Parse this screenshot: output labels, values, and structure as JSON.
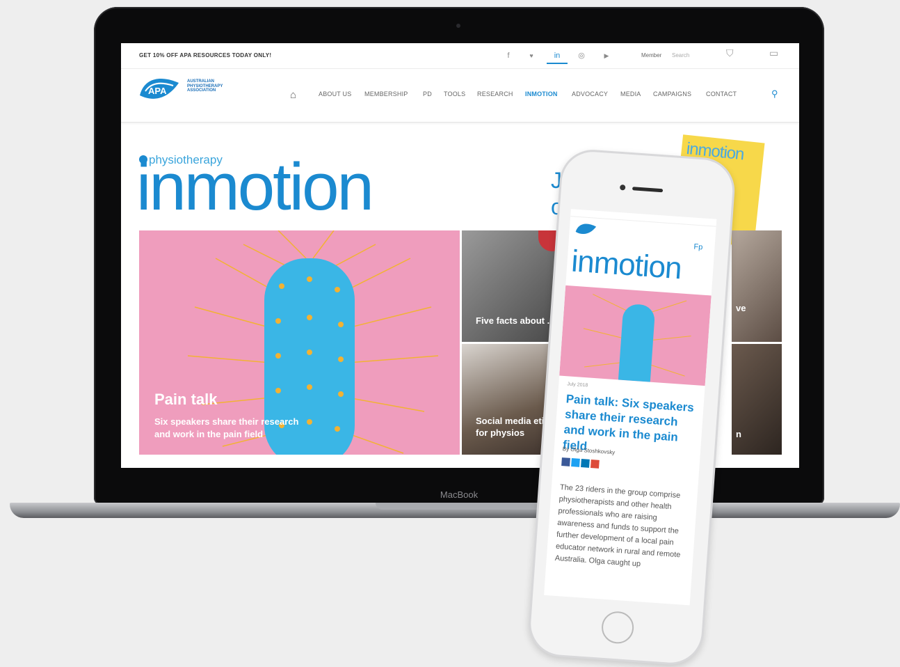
{
  "site": {
    "promo": "GET 10% OFF APA RESOURCES TODAY ONLY!",
    "social": [
      "f",
      "♥",
      "in",
      "◎",
      "▶"
    ],
    "member_label": "Member",
    "member_link": "Search",
    "logo_text": [
      "AUSTRALIAN",
      "PHYSIOTHERAPY",
      "ASSOCIATION"
    ],
    "logo_mark": "APA",
    "nav": [
      "ABOUT US",
      "MEMBERSHIP",
      "PD",
      "TOOLS",
      "RESEARCH",
      "INMOTION",
      "ADVOCACY",
      "MEDIA",
      "CAMPAIGNS",
      "CONTACT"
    ],
    "active_nav": "INMOTION",
    "kicker": "physiotherapy",
    "masthead": "inmotion",
    "side_text_1": "J",
    "side_text_2": "o",
    "magazine_title": "inmotion",
    "hero": {
      "title": "Pain talk",
      "subtitle_1": "Six speakers share their research",
      "subtitle_2": "and work in the pain field"
    },
    "tiles": [
      {
        "label_1": "Five facts about .",
        "label_2": ""
      },
      {
        "label_1": "Social media etiq",
        "label_2": "for physios"
      },
      {
        "label_1": "ve",
        "label_2": ""
      },
      {
        "label_1": "n",
        "label_2": ""
      }
    ]
  },
  "laptop": {
    "brand": "MacBook"
  },
  "phone": {
    "masthead": "inmotion",
    "nav_short": "Fp",
    "date": "July 2018",
    "title": "Pain talk: Six speakers share their research and work in the pain field",
    "byline": "By Olga Stoshkovsky",
    "body": "The 23 riders in the group comprise physiotherapists and other health professionals who are raising awareness and funds to support the further development of a local pain educator network in rural and remote Australia. Olga caught up"
  },
  "colors": {
    "accent": "#1b8ad0",
    "pink": "#ef9dbd",
    "cactus": "#3ab6e6",
    "spikes": "#f2b233",
    "magazine": "#f7d84a"
  }
}
